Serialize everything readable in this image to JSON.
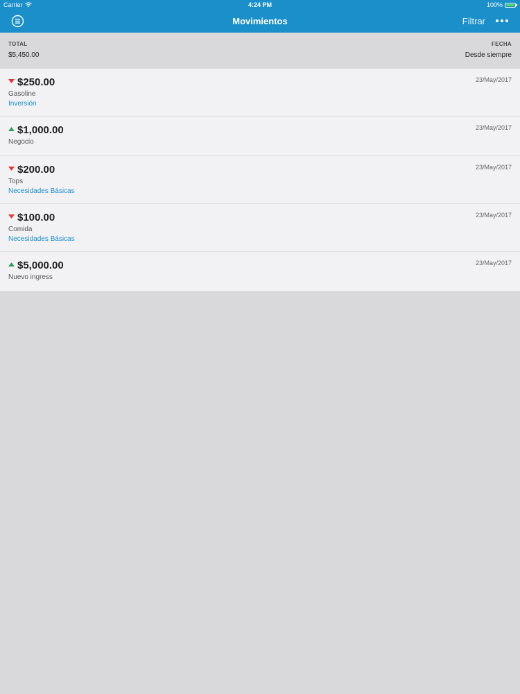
{
  "status_bar": {
    "carrier": "Carrier",
    "time": "4:24 PM",
    "battery": "100%"
  },
  "nav": {
    "title": "Movimientos",
    "filter_label": "Filtrar",
    "menu_icon": "list-menu-icon",
    "more_icon": "more-dots-icon"
  },
  "summary": {
    "total_label": "TOTAL",
    "total_value": "$5,450.00",
    "date_label": "FECHA",
    "date_value": "Desde siempre"
  },
  "colors": {
    "accent": "#1a8fc9",
    "expense": "#e53935",
    "income": "#2e9e5b",
    "background": "#d9d9dc"
  },
  "movements": [
    {
      "direction": "down",
      "amount": "$250.00",
      "name": "Gasoline",
      "category": "Inversión",
      "date": "23/May/2017"
    },
    {
      "direction": "up",
      "amount": "$1,000.00",
      "name": "Negocio",
      "category": "",
      "date": "23/May/2017"
    },
    {
      "direction": "down",
      "amount": "$200.00",
      "name": "Tops",
      "category": "Necesidades Básicas",
      "date": "23/May/2017"
    },
    {
      "direction": "down",
      "amount": "$100.00",
      "name": "Comida",
      "category": "Necesidades Básicas",
      "date": "23/May/2017"
    },
    {
      "direction": "up",
      "amount": "$5,000.00",
      "name": "Nuevo ingress",
      "category": "",
      "date": "23/May/2017"
    }
  ]
}
